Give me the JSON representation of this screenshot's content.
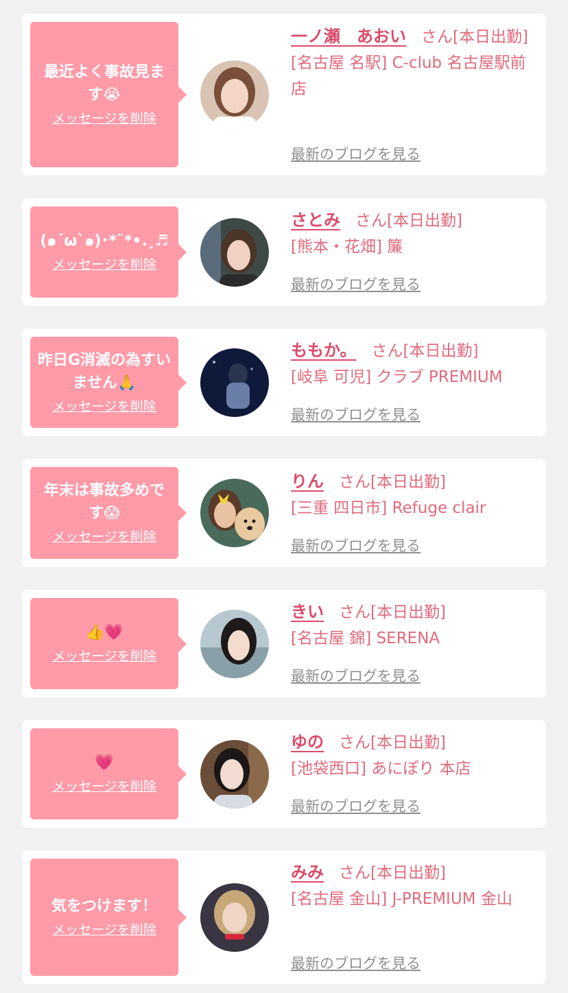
{
  "labels": {
    "delete": "メッセージを削除",
    "blog": "最新のブログを見る"
  },
  "colors": {
    "bubble": "#ff9aa8",
    "name": "#dc4a6a",
    "text": "#e06a7c",
    "link_gray": "#8e8e8e",
    "background": "#f1f1f1"
  },
  "cards": [
    {
      "message": "最近よく事故見ます😭",
      "name": "一ノ瀬　あおい",
      "status": "さん[本日出勤]",
      "shop": "[名古屋 名駅] C-club 名古屋駅前店"
    },
    {
      "message": "(๑´ω`๑)･*¨*•.¸♬",
      "name": "さとみ",
      "status": "さん[本日出勤]",
      "shop": "[熊本・花畑] 簾"
    },
    {
      "message": "昨日G消滅の為すいません🙏",
      "name": "ももか。",
      "status": "さん[本日出勤]",
      "shop": "[岐阜 可児] クラブ PREMIUM"
    },
    {
      "message": "年末は事故多めです😱",
      "name": "りん",
      "status": "さん[本日出勤]",
      "shop": "[三重 四日市] Refuge clair"
    },
    {
      "message": "👍💗",
      "name": "きい",
      "status": "さん[本日出勤]",
      "shop": "[名古屋 錦] SERENA"
    },
    {
      "message": "💗",
      "name": "ゆの",
      "status": "さん[本日出勤]",
      "shop": "[池袋西口] あにぽり 本店"
    },
    {
      "message": "気をつけます！",
      "name": "みみ",
      "status": "さん[本日出勤]",
      "shop": "[名古屋 金山] J-PREMIUM 金山"
    }
  ]
}
